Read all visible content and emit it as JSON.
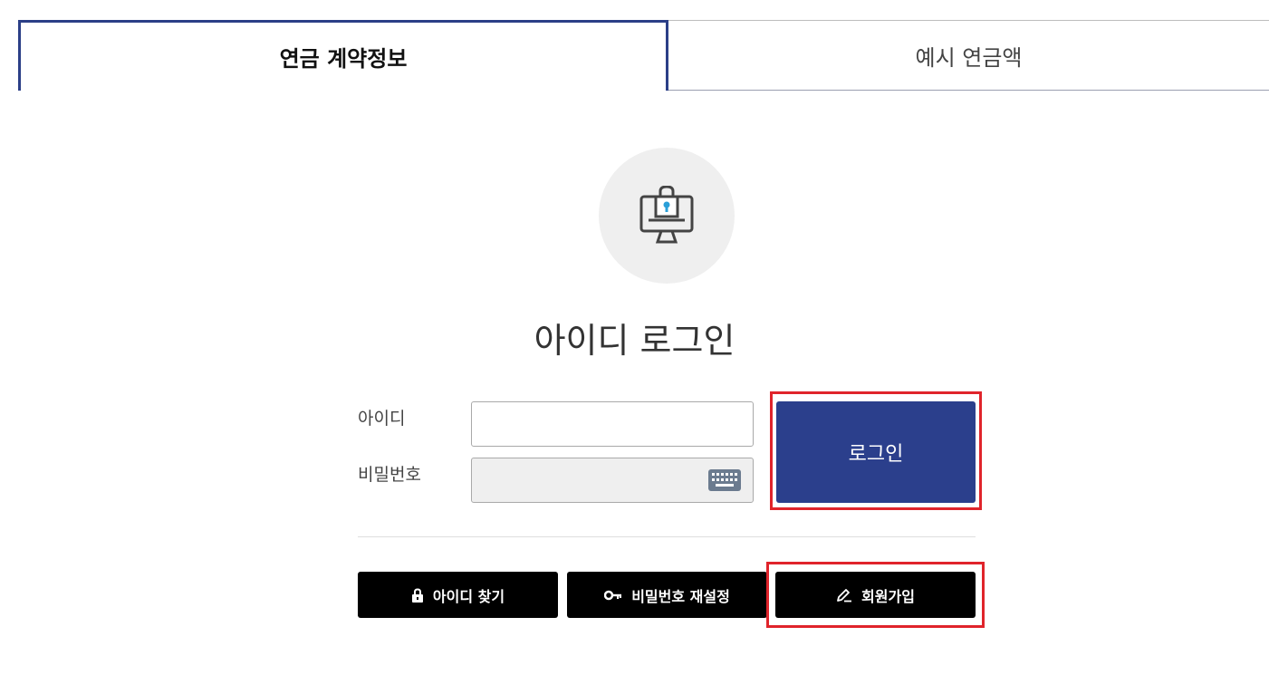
{
  "tabs": [
    {
      "label": "연금 계약정보",
      "active": true
    },
    {
      "label": "예시 연금액",
      "active": false
    }
  ],
  "login": {
    "title": "아이디 로그인",
    "id_label": "아이디",
    "id_value": "",
    "password_label": "비밀번호",
    "password_value": "",
    "submit_label": "로그인"
  },
  "links": {
    "find_id": "아이디 찾기",
    "reset_password": "비밀번호 재설정",
    "signup": "회원가입"
  },
  "icons": {
    "hero": "computer-lock-icon",
    "keyboard": "keyboard-icon",
    "find_id": "lock-icon",
    "reset_password": "key-icon",
    "signup": "pencil-icon"
  },
  "colors": {
    "primary": "#2b3f8c",
    "highlight": "#e0242b",
    "dark_button": "#000000"
  }
}
